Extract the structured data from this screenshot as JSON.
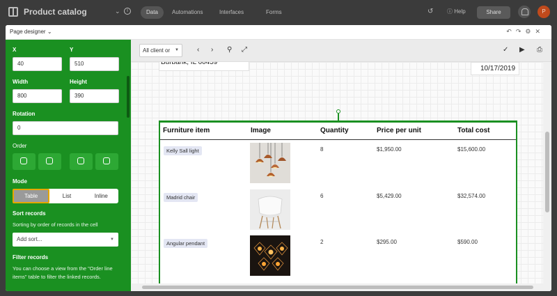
{
  "app": {
    "title": "Product catalog",
    "tabs": [
      "Data",
      "Automations",
      "Interfaces",
      "Forms"
    ],
    "help_label": "Help",
    "share_label": "Share",
    "avatar_initial": "P"
  },
  "modal": {
    "title": "Page designer"
  },
  "panel": {
    "x_label": "X",
    "x_value": "40",
    "y_label": "Y",
    "y_value": "510",
    "width_label": "Width",
    "width_value": "800",
    "height_label": "Height",
    "height_value": "390",
    "rotation_label": "Rotation",
    "rotation_value": "0",
    "order_label": "Order",
    "mode_label": "Mode",
    "mode_options": [
      "Table",
      "List",
      "Inline"
    ],
    "mode_selected": "Table",
    "sort_label": "Sort records",
    "sort_desc": "Sorting by order of records in the cell",
    "sort_placeholder": "Add sort...",
    "filter_label": "Filter records",
    "filter_desc": "You can choose a view from the \"Order line items\" table to filter the linked records."
  },
  "toolbar": {
    "record_select": "All client or"
  },
  "page": {
    "address": "Burbank, IL 60459",
    "date": "10/17/2019",
    "table": {
      "headers": [
        "Furniture item",
        "Image",
        "Quantity",
        "Price per unit",
        "Total cost"
      ],
      "rows": [
        {
          "item": "Kelly Sall light",
          "quantity": "8",
          "price": "$1,950.00",
          "total": "$15,600.00",
          "image": "copper-pendant-lights"
        },
        {
          "item": "Madrid chair",
          "quantity": "6",
          "price": "$5,429.00",
          "total": "$32,574.00",
          "image": "white-shell-chair"
        },
        {
          "item": "Angular pendant",
          "quantity": "2",
          "price": "$295.00",
          "total": "$590.00",
          "image": "geometric-pendant-lights"
        }
      ]
    }
  },
  "colors": {
    "panel_green": "#1a9021",
    "selected_outline": "#e6a700",
    "avatar": "#c04a1c"
  }
}
